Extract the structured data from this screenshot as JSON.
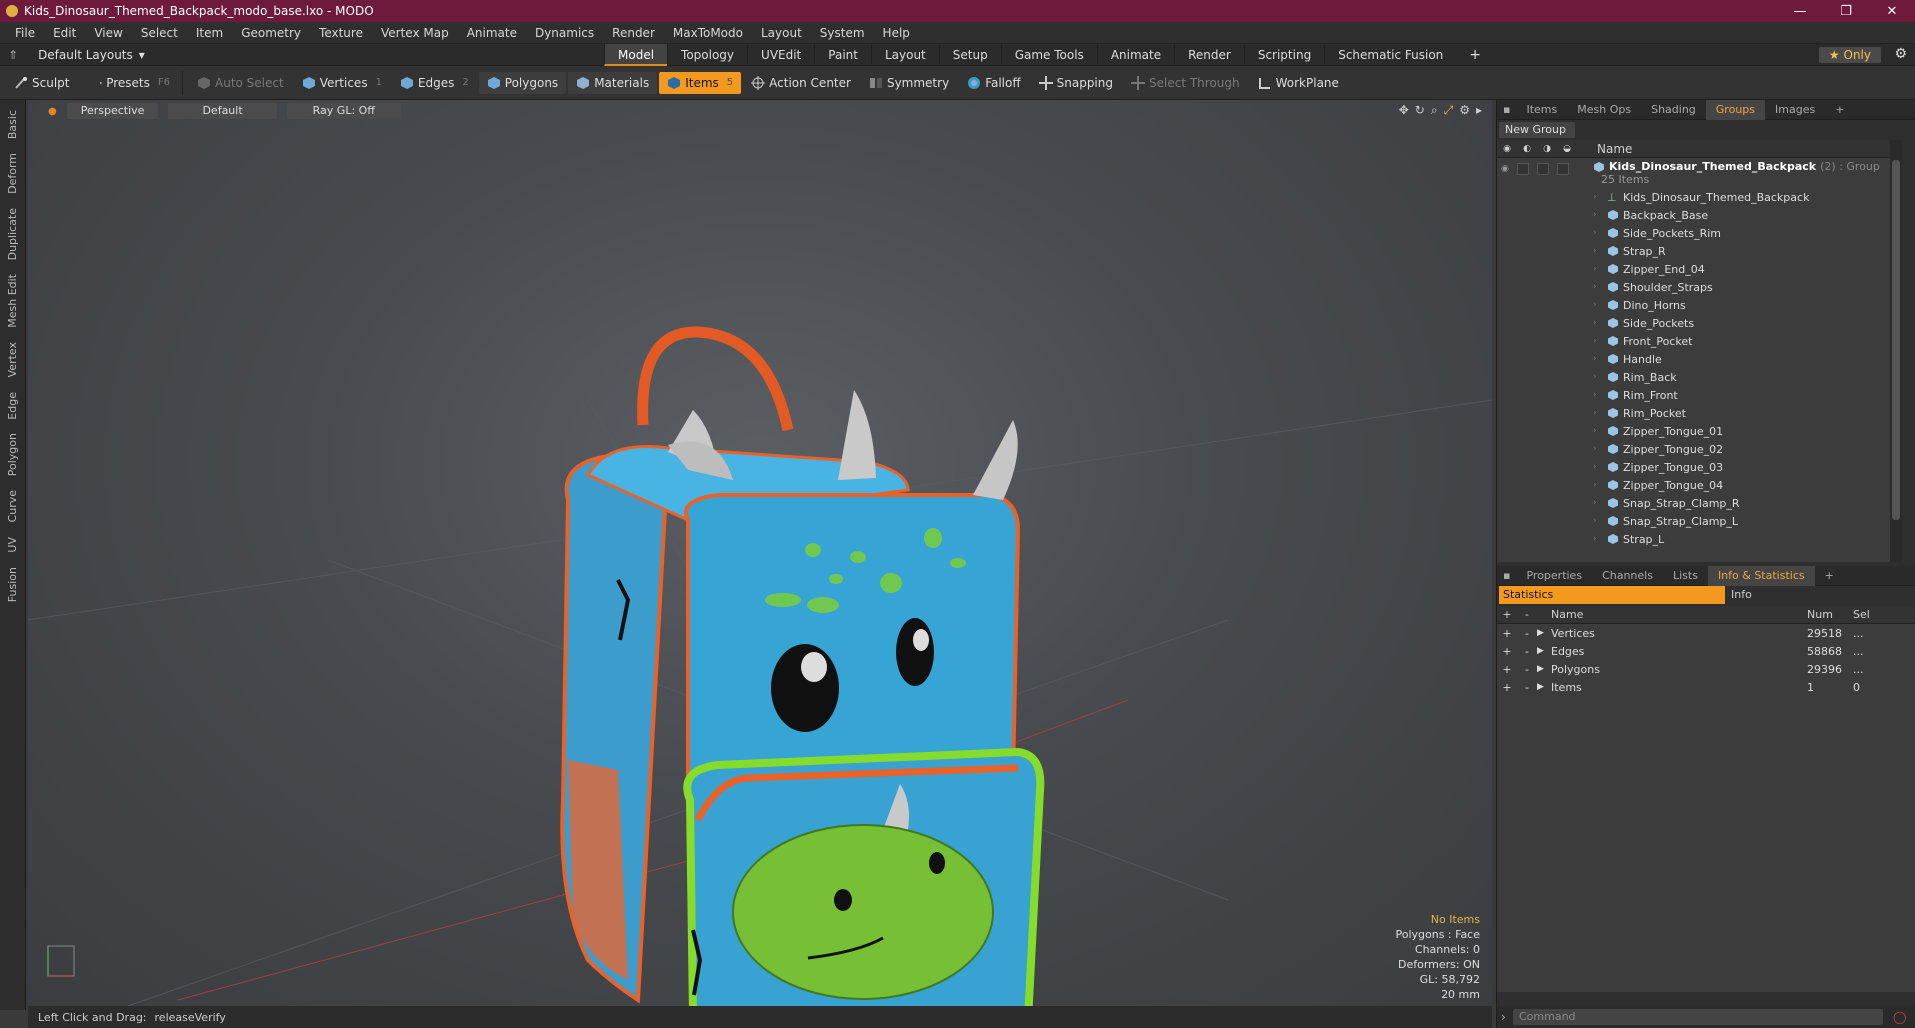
{
  "window": {
    "title": "Kids_Dinosaur_Themed_Backpack_modo_base.lxo - MODO",
    "controls": [
      "—",
      "❐",
      "✕"
    ]
  },
  "menu": [
    "File",
    "Edit",
    "View",
    "Select",
    "Item",
    "Geometry",
    "Texture",
    "Vertex Map",
    "Animate",
    "Dynamics",
    "Render",
    "MaxToModo",
    "Layout",
    "System",
    "Help"
  ],
  "layouts": {
    "label": "Default Layouts",
    "tabs": [
      "Model",
      "Topology",
      "UVEdit",
      "Paint",
      "Layout",
      "Setup",
      "Game Tools",
      "Animate",
      "Render",
      "Scripting",
      "Schematic Fusion"
    ],
    "active": "Model",
    "only_label": "Only",
    "plus": "+"
  },
  "toolbar": {
    "sculpt": "Sculpt",
    "presets": "Presets",
    "presets_key": "F6",
    "auto_select": "Auto Select",
    "vertices": "Vertices",
    "vertices_count": "1",
    "edges": "Edges",
    "edges_count": "2",
    "polygons": "Polygons",
    "materials": "Materials",
    "items": "Items",
    "items_count": "5",
    "action_center": "Action Center",
    "symmetry": "Symmetry",
    "falloff": "Falloff",
    "snapping": "Snapping",
    "select_through": "Select Through",
    "workplane": "WorkPlane"
  },
  "left_tabs": [
    "Basic",
    "Deform",
    "Duplicate",
    "Mesh Edit",
    "Vertex",
    "Edge",
    "Polygon",
    "Curve",
    "UV",
    "Fusion"
  ],
  "viewport": {
    "view": "Perspective",
    "shading": "Default",
    "raygl": "Ray GL: Off",
    "info": {
      "status": "No Items",
      "polygons": "Polygons : Face",
      "channels": "Channels: 0",
      "deformers": "Deformers: ON",
      "gl": "GL: 58,792",
      "scale": "20 mm"
    }
  },
  "statusbar": {
    "hint": "Left Click and Drag:",
    "action": "releaseVerify"
  },
  "scene_panel": {
    "tabs": [
      "Items",
      "Mesh Ops",
      "Shading",
      "Groups",
      "Images"
    ],
    "active": "Groups",
    "plus": "+",
    "new_group": "New Group",
    "name_header": "Name",
    "group": {
      "name": "Kids_Dinosaur_Themed_Backpack",
      "suffix": "(2) : Group",
      "count": "25 Items"
    },
    "items": [
      "Kids_Dinosaur_Themed_Backpack",
      "Backpack_Base",
      "Side_Pockets_Rim",
      "Strap_R",
      "Zipper_End_04",
      "Shoulder_Straps",
      "Dino_Horns",
      "Side_Pockets",
      "Front_Pocket",
      "Handle",
      "Rim_Back",
      "Rim_Front",
      "Rim_Pocket",
      "Zipper_Tongue_01",
      "Zipper_Tongue_02",
      "Zipper_Tongue_03",
      "Zipper_Tongue_04",
      "Snap_Strap_Clamp_R",
      "Snap_Strap_Clamp_L",
      "Strap_L"
    ]
  },
  "props_panel": {
    "tabs": [
      "Properties",
      "Channels",
      "Lists",
      "Info & Statistics"
    ],
    "active": "Info & Statistics",
    "plus": "+",
    "subtabs": [
      "Statistics",
      "Info"
    ],
    "headers": {
      "name": "Name",
      "num": "Num",
      "sel": "Sel"
    },
    "rows": [
      {
        "name": "Vertices",
        "num": "29518",
        "sel": "..."
      },
      {
        "name": "Edges",
        "num": "58868",
        "sel": "..."
      },
      {
        "name": "Polygons",
        "num": "29396",
        "sel": "..."
      },
      {
        "name": "Items",
        "num": "1",
        "sel": "0"
      }
    ]
  },
  "command": {
    "placeholder": "Command"
  },
  "colors": {
    "titlebar": "#6d1a3c",
    "accent": "#f39a1e",
    "backpack_blue": "#3aa7d6",
    "backpack_green": "#7ed321",
    "trim_orange": "#e8622a"
  }
}
